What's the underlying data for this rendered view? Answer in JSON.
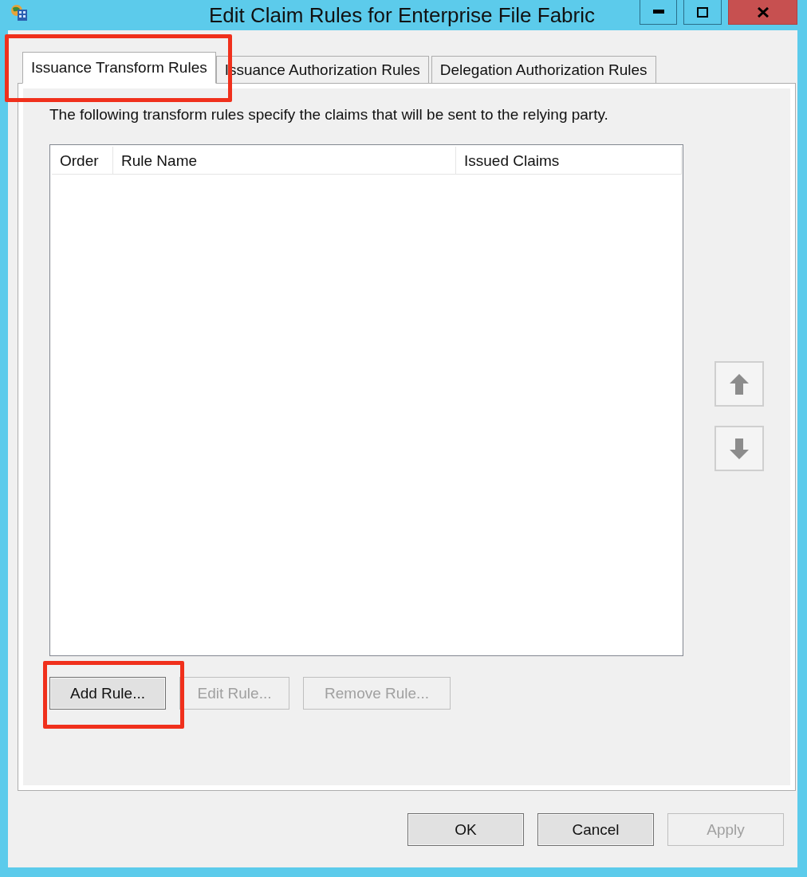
{
  "window": {
    "title": "Edit Claim Rules for Enterprise File Fabric"
  },
  "tabs": [
    {
      "label": "Issuance Transform Rules",
      "selected": true,
      "highlighted": true
    },
    {
      "label": "Issuance Authorization Rules",
      "selected": false,
      "highlighted": false
    },
    {
      "label": "Delegation Authorization Rules",
      "selected": false,
      "highlighted": false
    }
  ],
  "description": "The following transform rules specify the claims that will be sent to the relying party.",
  "table": {
    "columns": [
      "Order",
      "Rule Name",
      "Issued Claims"
    ]
  },
  "move_buttons": [
    {
      "kind": "up",
      "disabled": true
    },
    {
      "kind": "down",
      "disabled": true
    }
  ],
  "rule_buttons": [
    {
      "label": "Add Rule...",
      "disabled": false,
      "highlighted": true
    },
    {
      "label": "Edit Rule...",
      "disabled": true,
      "highlighted": false
    },
    {
      "label": "Remove Rule...",
      "disabled": true,
      "highlighted": false
    }
  ],
  "dialog_buttons": [
    {
      "label": "OK",
      "disabled": false
    },
    {
      "label": "Cancel",
      "disabled": false
    },
    {
      "label": "Apply",
      "disabled": true
    }
  ]
}
